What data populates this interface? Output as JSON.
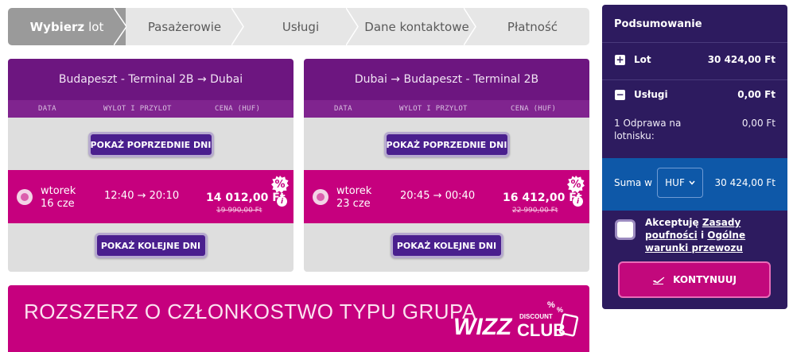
{
  "steps": [
    {
      "bold": "Wybierz",
      "label": "lot"
    },
    {
      "label": "Pasażerowie"
    },
    {
      "label": "Usługi"
    },
    {
      "label": "Dane kontaktowe"
    },
    {
      "label": "Płatność"
    }
  ],
  "columns": {
    "date": "DATA",
    "times": "WYLOT I PRZYLOT",
    "price": "CENA (HUF)"
  },
  "outbound": {
    "route": "Budapeszt - Terminal 2B → Dubai",
    "prev_btn": "POKAŻ POPRZEDNIE DNI",
    "next_btn": "POKAŻ KOLEJNE DNI",
    "weekday": "wtorek",
    "date": "16 cze",
    "times": "12:40 → 20:10",
    "price": "14 012,00 Ft",
    "old_price": "19 990,00 Ft"
  },
  "inbound": {
    "route": "Dubai → Budapeszt - Terminal 2B",
    "prev_btn": "POKAŻ POPRZEDNIE DNI",
    "next_btn": "POKAŻ KOLEJNE DNI",
    "weekday": "wtorek",
    "date": "23 cze",
    "times": "20:45 → 00:40",
    "price": "16 412,00 Ft",
    "old_price": "22 990,00 Ft"
  },
  "badge": {
    "percent": "%",
    "info": "i"
  },
  "banner": {
    "title": "ROZSZERZ O CZŁONKOSTWO TYPU GRUPA",
    "logo_wizz": "WIZZ",
    "logo_discount": "DISCOUNT",
    "logo_club": "CLUB"
  },
  "summary": {
    "title": "Podsumowanie",
    "flight": {
      "toggle": "+",
      "label": "Lot",
      "value": "30 424,00 Ft"
    },
    "services": {
      "toggle": "−",
      "label": "Usługi",
      "value": "0,00 Ft"
    },
    "detail": {
      "label": "1 Odprawa na lotnisku:",
      "value": "0,00 Ft"
    },
    "total": {
      "label": "Suma w",
      "currency": "HUF",
      "value": "30 424,00 Ft"
    },
    "consent": {
      "prefix": "Akceptuję",
      "link1": "Zasady poufności",
      "mid": "i",
      "link2": "Ogólne warunki przewozu"
    },
    "continue": "KONTYNUUJ"
  },
  "colors": {
    "purple": "#6d1680",
    "magenta": "#c6007e",
    "navy": "#2d1b5f",
    "blue": "#0e58a8"
  }
}
